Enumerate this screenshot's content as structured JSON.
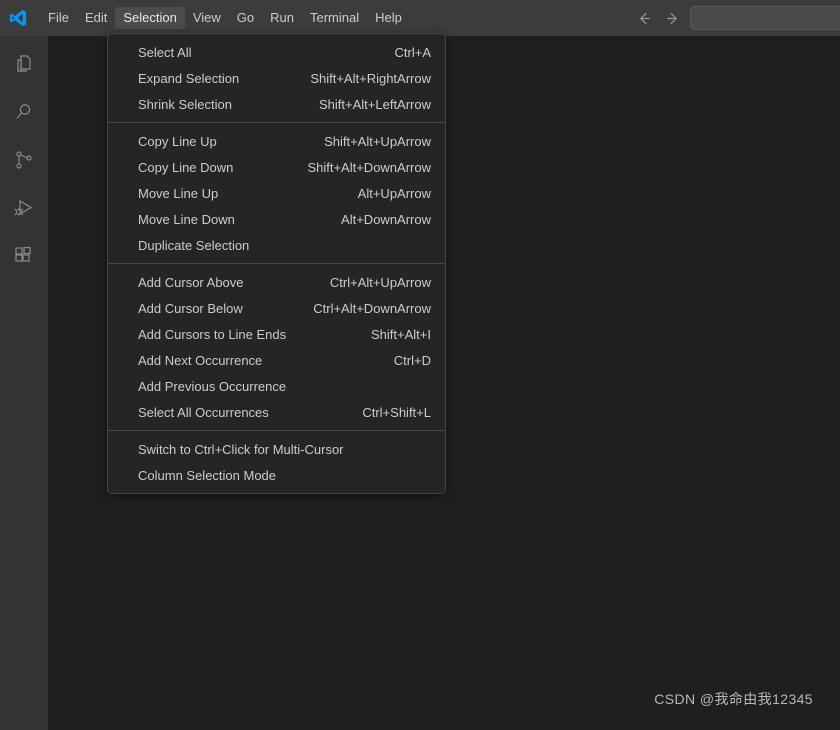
{
  "titlebar": {
    "logo_icon": "vscode-logo-icon",
    "menus": [
      {
        "label": "File",
        "active": false
      },
      {
        "label": "Edit",
        "active": false
      },
      {
        "label": "Selection",
        "active": true
      },
      {
        "label": "View",
        "active": false
      },
      {
        "label": "Go",
        "active": false
      },
      {
        "label": "Run",
        "active": false
      },
      {
        "label": "Terminal",
        "active": false
      },
      {
        "label": "Help",
        "active": false
      }
    ],
    "back_icon": "arrow-left-icon",
    "forward_icon": "arrow-right-icon",
    "command_center": {
      "value": "",
      "placeholder": ""
    }
  },
  "activitybar": {
    "items": [
      {
        "icon": "explorer-files-icon",
        "label": "Explorer"
      },
      {
        "icon": "search-icon",
        "label": "Search"
      },
      {
        "icon": "source-control-branch-icon",
        "label": "Source Control"
      },
      {
        "icon": "run-and-debug-icon",
        "label": "Run and Debug"
      },
      {
        "icon": "extensions-icon",
        "label": "Extensions"
      }
    ]
  },
  "selection_menu": {
    "groups": [
      {
        "items": [
          {
            "label": "Select All",
            "keybinding": "Ctrl+A"
          },
          {
            "label": "Expand Selection",
            "keybinding": "Shift+Alt+RightArrow"
          },
          {
            "label": "Shrink Selection",
            "keybinding": "Shift+Alt+LeftArrow"
          }
        ]
      },
      {
        "items": [
          {
            "label": "Copy Line Up",
            "keybinding": "Shift+Alt+UpArrow"
          },
          {
            "label": "Copy Line Down",
            "keybinding": "Shift+Alt+DownArrow"
          },
          {
            "label": "Move Line Up",
            "keybinding": "Alt+UpArrow"
          },
          {
            "label": "Move Line Down",
            "keybinding": "Alt+DownArrow"
          },
          {
            "label": "Duplicate Selection",
            "keybinding": ""
          }
        ]
      },
      {
        "items": [
          {
            "label": "Add Cursor Above",
            "keybinding": "Ctrl+Alt+UpArrow"
          },
          {
            "label": "Add Cursor Below",
            "keybinding": "Ctrl+Alt+DownArrow"
          },
          {
            "label": "Add Cursors to Line Ends",
            "keybinding": "Shift+Alt+I"
          },
          {
            "label": "Add Next Occurrence",
            "keybinding": "Ctrl+D"
          },
          {
            "label": "Add Previous Occurrence",
            "keybinding": ""
          },
          {
            "label": "Select All Occurrences",
            "keybinding": "Ctrl+Shift+L"
          }
        ]
      },
      {
        "items": [
          {
            "label": "Switch to Ctrl+Click for Multi-Cursor",
            "keybinding": ""
          },
          {
            "label": "Column Selection Mode",
            "keybinding": ""
          }
        ]
      }
    ]
  },
  "editor": {
    "watermark": "CSDN @我命由我12345"
  },
  "colors": {
    "titlebar_bg": "#3c3c3c",
    "activitybar_bg": "#333333",
    "editor_bg": "#1f1f1f",
    "menu_bg": "#252526",
    "menu_border": "#454545",
    "text": "#cccccc",
    "logo_blue": "#0098ff"
  }
}
